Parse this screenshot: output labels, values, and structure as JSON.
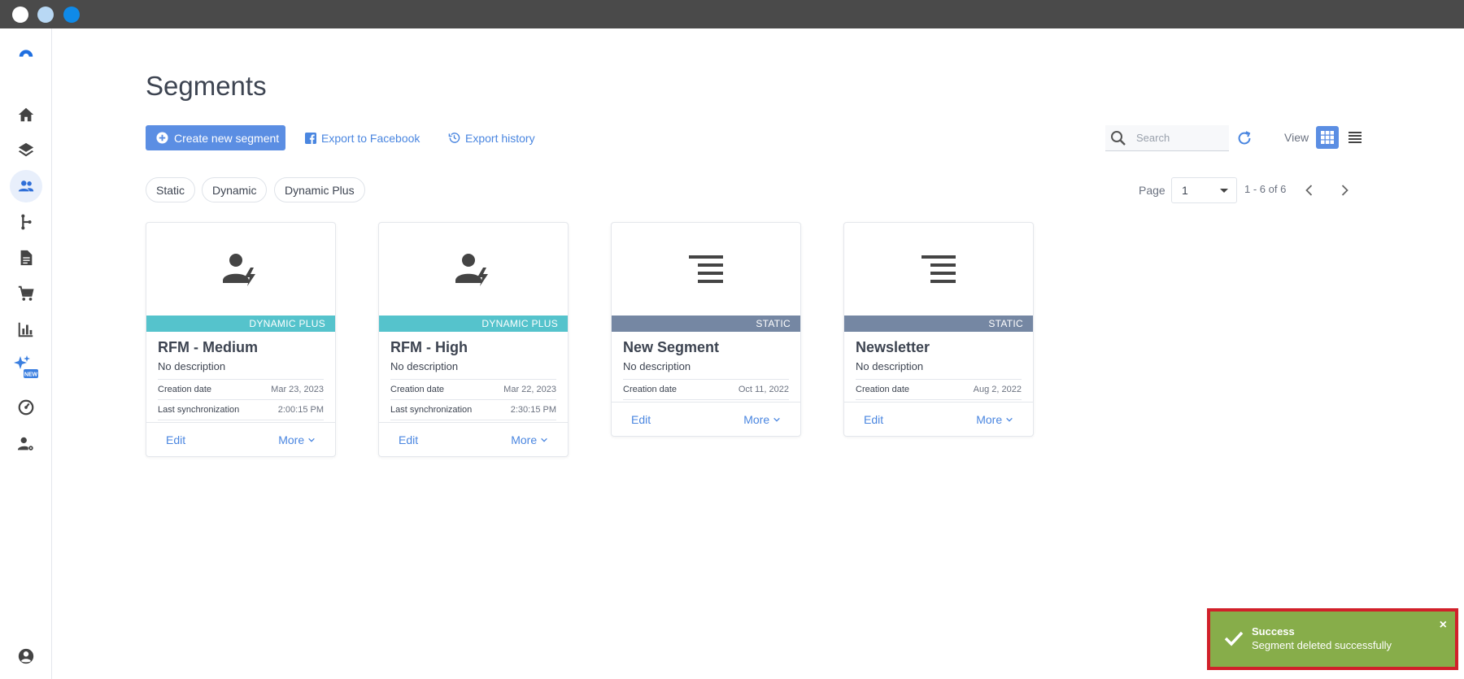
{
  "window": {
    "dot_colors": [
      "#ffffff",
      "#b8d8f4",
      "#0f8ae8"
    ]
  },
  "sidebar": {
    "items": [
      {
        "name": "logo-icon"
      },
      {
        "name": "home-icon"
      },
      {
        "name": "layers-icon"
      },
      {
        "name": "people-icon",
        "active": true
      },
      {
        "name": "flow-icon"
      },
      {
        "name": "document-icon"
      },
      {
        "name": "cart-icon"
      },
      {
        "name": "chart-icon"
      },
      {
        "name": "sparkle-new-icon",
        "badge": "NEW"
      },
      {
        "name": "speedometer-icon"
      },
      {
        "name": "user-settings-icon"
      },
      {
        "name": "account-icon"
      }
    ]
  },
  "page": {
    "title": "Segments"
  },
  "toolbar": {
    "create_label": "Create new segment",
    "export_facebook_label": "Export to Facebook",
    "export_history_label": "Export history",
    "search_placeholder": "Search",
    "view_label": "View"
  },
  "filters": [
    "Static",
    "Dynamic",
    "Dynamic Plus"
  ],
  "pagination": {
    "page_label": "Page",
    "page_value": "1",
    "range": "1 - 6 of 6"
  },
  "cards": [
    {
      "type": "DYNAMIC PLUS",
      "type_color": "#55c3cc",
      "name": "RFM - Medium",
      "description": "No description",
      "creation_label": "Creation date",
      "creation_date": "Mar 23, 2023",
      "sync_label": "Last synchronization",
      "sync_time": "2:00:15 PM",
      "edit_label": "Edit",
      "more_label": "More"
    },
    {
      "type": "DYNAMIC PLUS",
      "type_color": "#55c3cc",
      "name": "RFM - High",
      "description": "No description",
      "creation_label": "Creation date",
      "creation_date": "Mar 22, 2023",
      "sync_label": "Last synchronization",
      "sync_time": "2:30:15 PM",
      "edit_label": "Edit",
      "more_label": "More"
    },
    {
      "type": "STATIC",
      "type_color": "#7587a3",
      "name": "New Segment",
      "description": "No description",
      "creation_label": "Creation date",
      "creation_date": "Oct 11, 2022",
      "edit_label": "Edit",
      "more_label": "More"
    },
    {
      "type": "STATIC",
      "type_color": "#7587a3",
      "name": "Newsletter",
      "description": "No description",
      "creation_label": "Creation date",
      "creation_date": "Aug 2, 2022",
      "edit_label": "Edit",
      "more_label": "More"
    }
  ],
  "toast": {
    "title": "Success",
    "message": "Segment deleted successfully",
    "close": "×",
    "background": "#87ad4a"
  },
  "colors": {
    "accent": "#5b8ee3",
    "link": "#4a86e0"
  }
}
